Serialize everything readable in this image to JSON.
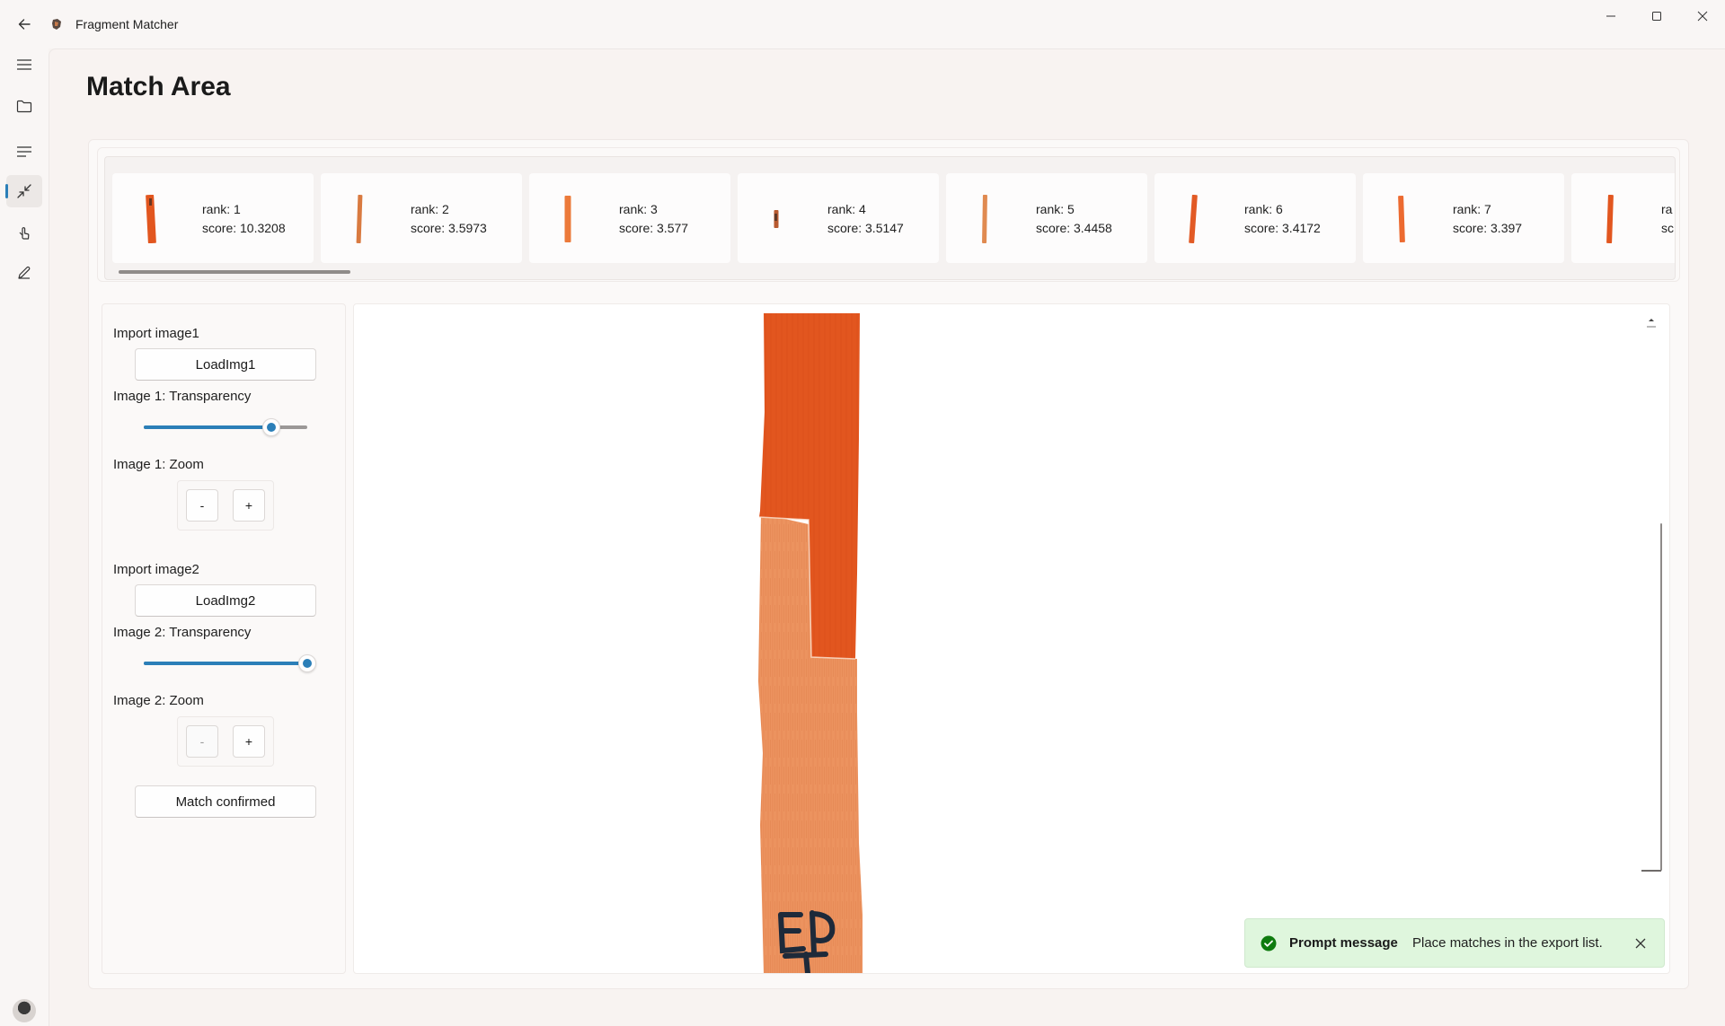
{
  "window": {
    "app_title": "Fragment Matcher",
    "controls": [
      "minimize-icon",
      "maximize-icon",
      "close-icon"
    ]
  },
  "navigation": {
    "items": [
      {
        "icon": "hamburger-menu-icon",
        "active": false
      },
      {
        "icon": "folder-icon",
        "active": false
      },
      {
        "icon": "list-lines-icon",
        "active": false
      },
      {
        "icon": "arrows-in-icon",
        "active": true
      },
      {
        "icon": "pointer-hand-icon",
        "active": false
      },
      {
        "icon": "pen-icon",
        "active": false
      }
    ],
    "footer": [
      "avatar",
      "gear-icon"
    ]
  },
  "page": {
    "title": "Match Area"
  },
  "candidates": [
    {
      "rank": "rank: 1",
      "score": "score: 10.3208"
    },
    {
      "rank": "rank: 2",
      "score": "score: 3.5973"
    },
    {
      "rank": "rank: 3",
      "score": "score: 3.577"
    },
    {
      "rank": "rank: 4",
      "score": "score: 3.5147"
    },
    {
      "rank": "rank: 5",
      "score": "score: 3.4458"
    },
    {
      "rank": "rank: 6",
      "score": "score: 3.4172"
    },
    {
      "rank": "rank: 7",
      "score": "score: 3.397"
    },
    {
      "rank": "ra",
      "score": "sc"
    }
  ],
  "controls": {
    "image1": {
      "import_label": "Import image1",
      "load_button": "LoadImg1",
      "transparency_label": "Image 1: Transparency",
      "transparency_value": 0.78,
      "zoom_label": "Image 1: Zoom",
      "zoom_out": "-",
      "zoom_in": "+"
    },
    "image2": {
      "import_label": "Import image2",
      "load_button": "LoadImg2",
      "transparency_label": "Image 2: Transparency",
      "transparency_value": 1.0,
      "zoom_label": "Image 2: Zoom",
      "zoom_out": "-",
      "zoom_in": "+"
    },
    "confirm_button": "Match confirmed"
  },
  "toast": {
    "title": "Prompt message",
    "message": "Place matches in the export list.",
    "status": "success"
  },
  "colors": {
    "accent": "#2b7fb8",
    "fragment_top": "#e2561f",
    "fragment_bottom": "#ec935f",
    "toast_bg": "#dff6dd",
    "toast_icon": "#0f7b0f"
  }
}
